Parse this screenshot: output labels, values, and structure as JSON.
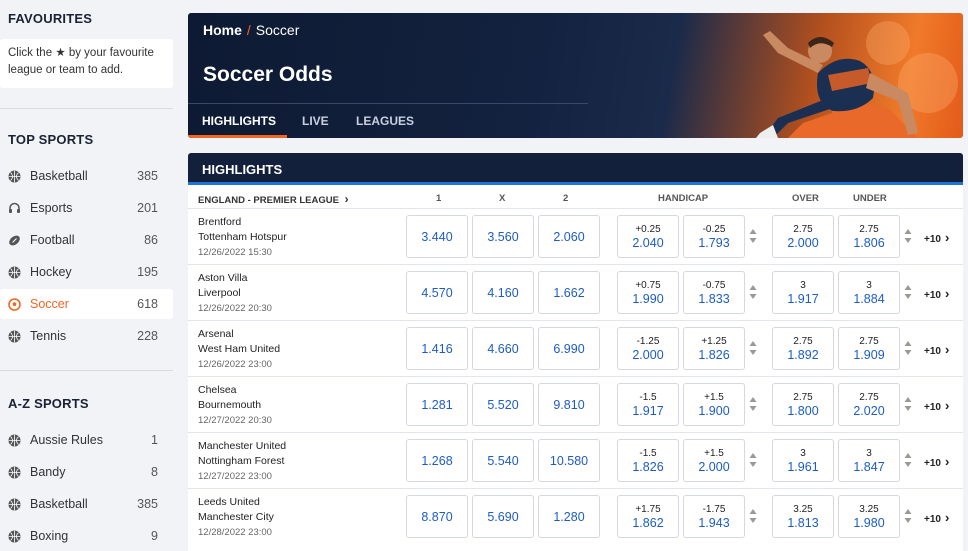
{
  "sidebar": {
    "favourites_title": "FAVOURITES",
    "favourites_hint_pre": "Click the",
    "favourites_hint_star": "★",
    "favourites_hint_post": "by your favourite league or team to add.",
    "top_sports_title": "TOP SPORTS",
    "top_sports": [
      {
        "label": "Basketball",
        "count": "385",
        "icon": "basketball-icon"
      },
      {
        "label": "Esports",
        "count": "201",
        "icon": "headset-icon"
      },
      {
        "label": "Football",
        "count": "86",
        "icon": "football-icon"
      },
      {
        "label": "Hockey",
        "count": "195",
        "icon": "hockey-icon"
      },
      {
        "label": "Soccer",
        "count": "618",
        "icon": "soccer-icon",
        "active": true
      },
      {
        "label": "Tennis",
        "count": "228",
        "icon": "tennis-icon"
      }
    ],
    "az_title": "A-Z SPORTS",
    "az_sports": [
      {
        "label": "Aussie Rules",
        "count": "1",
        "icon": "aussie-rules-icon"
      },
      {
        "label": "Bandy",
        "count": "8",
        "icon": "bandy-icon"
      },
      {
        "label": "Basketball",
        "count": "385",
        "icon": "basketball-icon"
      },
      {
        "label": "Boxing",
        "count": "9",
        "icon": "boxing-icon"
      }
    ]
  },
  "hero": {
    "crumb_home": "Home",
    "crumb_sep": "/",
    "crumb_current": "Soccer",
    "title": "Soccer Odds",
    "tabs": [
      "HIGHLIGHTS",
      "LIVE",
      "LEAGUES"
    ]
  },
  "odds": {
    "panel_title": "HIGHLIGHTS",
    "league": "ENGLAND - PREMIER LEAGUE",
    "col_1": "1",
    "col_x": "X",
    "col_2": "2",
    "col_handicap": "HANDICAP",
    "col_over": "OVER",
    "col_under": "UNDER",
    "matches": [
      {
        "home": "Brentford",
        "away": "Tottenham Hotspur",
        "date": "12/26/2022 15:30",
        "o1": "3.440",
        "ox": "3.560",
        "o2": "2.060",
        "h1": "+0.25",
        "h1v": "2.040",
        "h2": "-0.25",
        "h2v": "1.793",
        "ov": "2.75",
        "ovv": "2.000",
        "un": "2.75",
        "unv": "1.806",
        "more": "+10"
      },
      {
        "home": "Aston Villa",
        "away": "Liverpool",
        "date": "12/26/2022 20:30",
        "o1": "4.570",
        "ox": "4.160",
        "o2": "1.662",
        "h1": "+0.75",
        "h1v": "1.990",
        "h2": "-0.75",
        "h2v": "1.833",
        "ov": "3",
        "ovv": "1.917",
        "un": "3",
        "unv": "1.884",
        "more": "+10"
      },
      {
        "home": "Arsenal",
        "away": "West Ham United",
        "date": "12/26/2022 23:00",
        "o1": "1.416",
        "ox": "4.660",
        "o2": "6.990",
        "h1": "-1.25",
        "h1v": "2.000",
        "h2": "+1.25",
        "h2v": "1.826",
        "ov": "2.75",
        "ovv": "1.892",
        "un": "2.75",
        "unv": "1.909",
        "more": "+10"
      },
      {
        "home": "Chelsea",
        "away": "Bournemouth",
        "date": "12/27/2022 20:30",
        "o1": "1.281",
        "ox": "5.520",
        "o2": "9.810",
        "h1": "-1.5",
        "h1v": "1.917",
        "h2": "+1.5",
        "h2v": "1.900",
        "ov": "2.75",
        "ovv": "1.800",
        "un": "2.75",
        "unv": "2.020",
        "more": "+10"
      },
      {
        "home": "Manchester United",
        "away": "Nottingham Forest",
        "date": "12/27/2022 23:00",
        "o1": "1.268",
        "ox": "5.540",
        "o2": "10.580",
        "h1": "-1.5",
        "h1v": "1.826",
        "h2": "+1.5",
        "h2v": "2.000",
        "ov": "3",
        "ovv": "1.961",
        "un": "3",
        "unv": "1.847",
        "more": "+10"
      },
      {
        "home": "Leeds United",
        "away": "Manchester City",
        "date": "12/28/2022 23:00",
        "o1": "8.870",
        "ox": "5.690",
        "o2": "1.280",
        "h1": "+1.75",
        "h1v": "1.862",
        "h2": "-1.75",
        "h2v": "1.943",
        "ov": "3.25",
        "ovv": "1.813",
        "un": "3.25",
        "unv": "1.980",
        "more": "+10"
      }
    ]
  },
  "colors": {
    "accent": "#f26522",
    "navy": "#12203b",
    "link_blue": "#1d5cc7",
    "bar_blue": "#1d73d8"
  }
}
